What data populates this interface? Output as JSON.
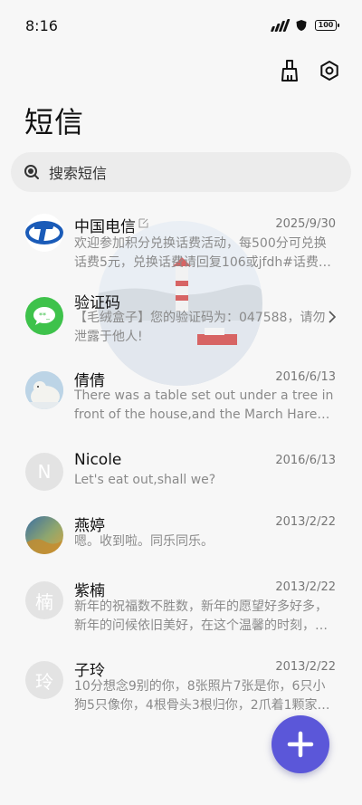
{
  "status_bar": {
    "time": "8:16",
    "battery": "100"
  },
  "page": {
    "title": "短信"
  },
  "search": {
    "placeholder": "搜索短信"
  },
  "conversations": [
    {
      "name": "中国电信",
      "date": "2025/9/30",
      "preview": "欢迎参加积分兑换话费活动，每500分可兑换话费5元，兑换话费请回复106或jfdh#话费…",
      "avatar": "china-telecom-logo"
    },
    {
      "name": "验证码",
      "date": "",
      "preview": "【毛绒盒子】您的验证码为：047588，请勿泄露于他人!",
      "avatar": "message-bubble-icon"
    },
    {
      "name": "倩倩",
      "date": "2016/6/13",
      "preview": "There was a table set out under a tree in front of the house,and the March Hare an…",
      "avatar": "polar-bear-photo"
    },
    {
      "name": "Nicole",
      "date": "2016/6/13",
      "preview": "Let's eat out,shall we?",
      "avatar": "N"
    },
    {
      "name": "燕婷",
      "date": "2013/2/22",
      "preview": "嗯。收到啦。同乐同乐。",
      "avatar": "landscape-photo"
    },
    {
      "name": "紫楠",
      "date": "2013/2/22",
      "preview": "新年的祝福数不胜数，新年的愿望好多好多，新年的问候依旧美好，在这个温馨的时刻，…",
      "avatar": "楠"
    },
    {
      "name": "子玲",
      "date": "2013/2/22",
      "preview": "10分想念9别的你，8张照片7张是你，6只小狗5只像你，4根骨头3根归你，2爪着1颗家…",
      "avatar": "玲"
    }
  ],
  "colors": {
    "accent": "#5b57d9",
    "telecom_blue": "#1a5bb8",
    "sms_green": "#3ec24b"
  }
}
